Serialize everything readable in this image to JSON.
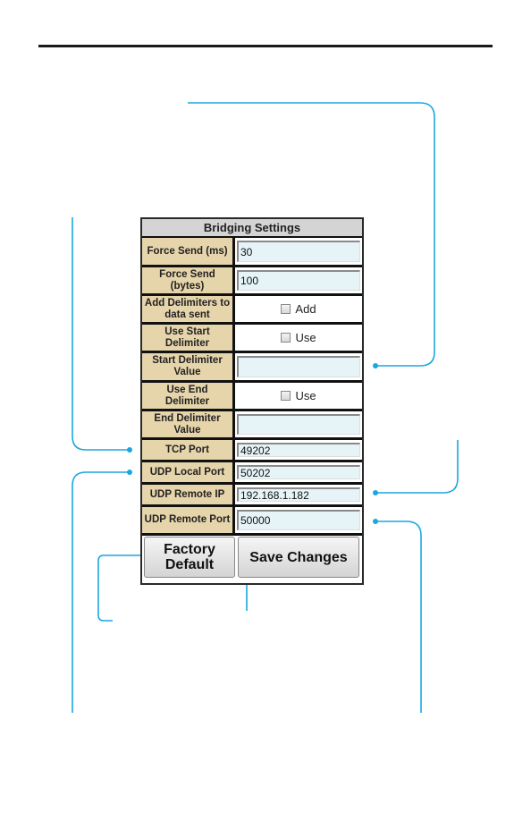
{
  "panel": {
    "title": "Bridging Settings",
    "rows": [
      {
        "label": "Force Send (ms)",
        "type": "text",
        "value": "30"
      },
      {
        "label": "Force Send (bytes)",
        "type": "text",
        "value": "100"
      },
      {
        "label": "Add Delimiters to data sent",
        "type": "checkbox",
        "checked": false,
        "check_label": "Add"
      },
      {
        "label": "Use Start Delimiter",
        "type": "checkbox",
        "checked": false,
        "check_label": "Use"
      },
      {
        "label": "Start Delimiter Value",
        "type": "text",
        "value": ""
      },
      {
        "label": "Use End Delimiter",
        "type": "checkbox",
        "checked": false,
        "check_label": "Use"
      },
      {
        "label": "End Delimiter Value",
        "type": "text",
        "value": ""
      },
      {
        "label": "TCP Port",
        "type": "text",
        "value": "49202"
      },
      {
        "label": "UDP Local Port",
        "type": "text",
        "value": "50202"
      },
      {
        "label": "UDP Remote IP",
        "type": "text",
        "value": "192.168.1.182"
      },
      {
        "label": "UDP Remote Port",
        "type": "text",
        "value": "50000"
      }
    ],
    "buttons": {
      "factory_default": "Factory Default",
      "save_changes": "Save Changes"
    }
  },
  "colors": {
    "callout": "#1aa7e0",
    "label_bg": "#e6d4ab",
    "input_bg": "#e6f4f8",
    "title_bg": "#d4d4d4"
  }
}
